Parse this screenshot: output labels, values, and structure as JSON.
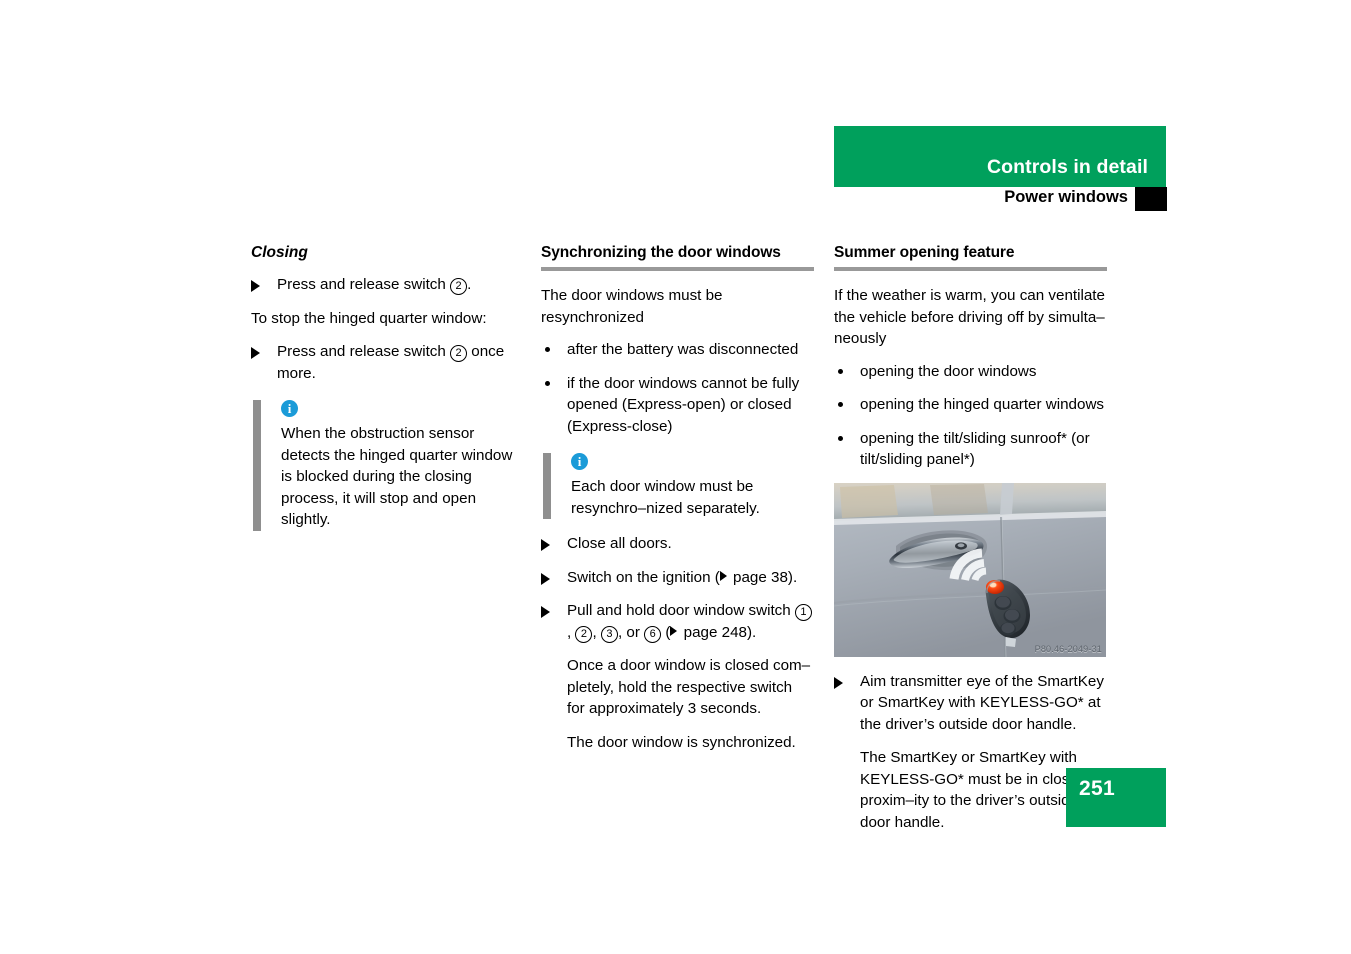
{
  "header": {
    "title": "Controls in detail",
    "subtitle": "Power windows",
    "green": "#00a05c",
    "tab_color": "#000000"
  },
  "left_column": {
    "heading": "Closing",
    "step1": "Press and release switch ",
    "step1_num": "2",
    "step1_tail": ".",
    "para1": "To stop the hinged quarter window:",
    "step2": "Press and release switch ",
    "step2_num": "2",
    "step2_tail": " once more.",
    "note": {
      "icon": "info-icon",
      "text": "When the obstruction sensor detects the hinged quarter window is blocked during the closing process, it will stop and open slightly."
    }
  },
  "middle_column": {
    "heading": "Synchronizing the door windows",
    "intro": "The door windows must be resynchronized",
    "bullets": [
      "after the battery was disconnected",
      "if the door windows cannot be fully opened (Express-open) or closed (Express-close)"
    ],
    "note": {
      "icon": "info-icon",
      "text": "Each door window must be resynchro–nized separately."
    },
    "step1": "Close all doors.",
    "step2_pre": "Switch on the ignition (",
    "step2_page": " page 38).",
    "step3_pre": "Pull and hold door window switch ",
    "step3_n1": "1",
    "step3_sep1": ",",
    "step3_n2": "2",
    "step3_sep2": ",",
    "step3_n3": "3",
    "step3_sep3": ", or",
    "step3_n4": "6",
    "step3_page": " page 248).",
    "sub_para": "Once a door window is closed com–pletely, hold the respective switch for approximately 3 seconds.",
    "result": "The door window is synchronized."
  },
  "right_column": {
    "heading": "Summer opening feature",
    "intro": "If the weather is warm, you can ventilate the vehicle before driving off by simulta–neously",
    "bullets": [
      "opening the door windows",
      "opening the hinged quarter windows",
      "opening the tilt/sliding sunroof* (or tilt/sliding panel*)"
    ],
    "figure": {
      "alt": "SmartKey transmitter aimed at the driver's outside door handle",
      "code": "P80.46-2049-31"
    },
    "step1": "Aim transmitter eye of the SmartKey or SmartKey with KEYLESS-GO* at the driver’s outside door handle.",
    "sub_para": "The SmartKey or SmartKey with KEYLESS-GO* must be in close proxim–ity to the driver’s outside door handle."
  },
  "footer": {
    "page_number": "251"
  }
}
